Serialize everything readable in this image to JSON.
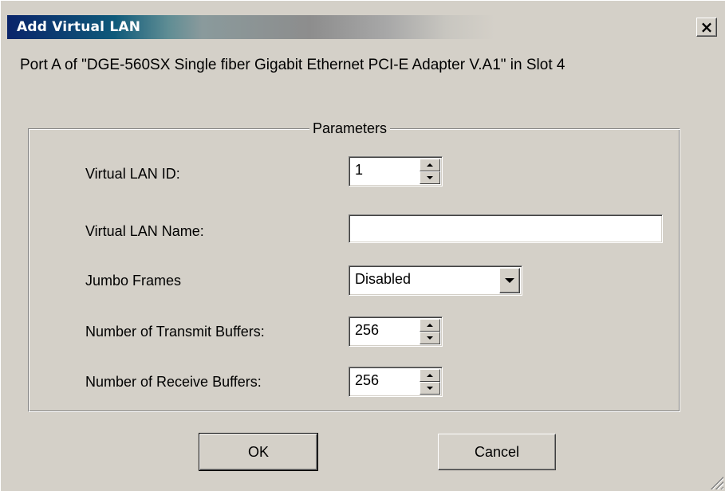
{
  "window": {
    "title": "Add Virtual LAN",
    "close_glyph": "×",
    "close_icon": "close-icon"
  },
  "description": "Port A of \"DGE-560SX Single fiber Gigabit Ethernet PCI-E Adapter V.A1\" in Slot 4",
  "parameters": {
    "group_label": "Parameters",
    "vlan_id": {
      "label": "Virtual LAN ID:",
      "value": "1"
    },
    "vlan_name": {
      "label": "Virtual LAN Name:",
      "value": "",
      "placeholder": ""
    },
    "jumbo_frames": {
      "label": "Jumbo Frames",
      "selected": "Disabled"
    },
    "transmit_buffers": {
      "label": "Number of Transmit Buffers:",
      "value": "256"
    },
    "receive_buffers": {
      "label": "Number of Receive Buffers:",
      "value": "256"
    }
  },
  "buttons": {
    "ok_label": "OK",
    "cancel_label": "Cancel"
  },
  "colors": {
    "title_bar_start": "#0a246a",
    "dialog_face": "#d4d0c8"
  }
}
